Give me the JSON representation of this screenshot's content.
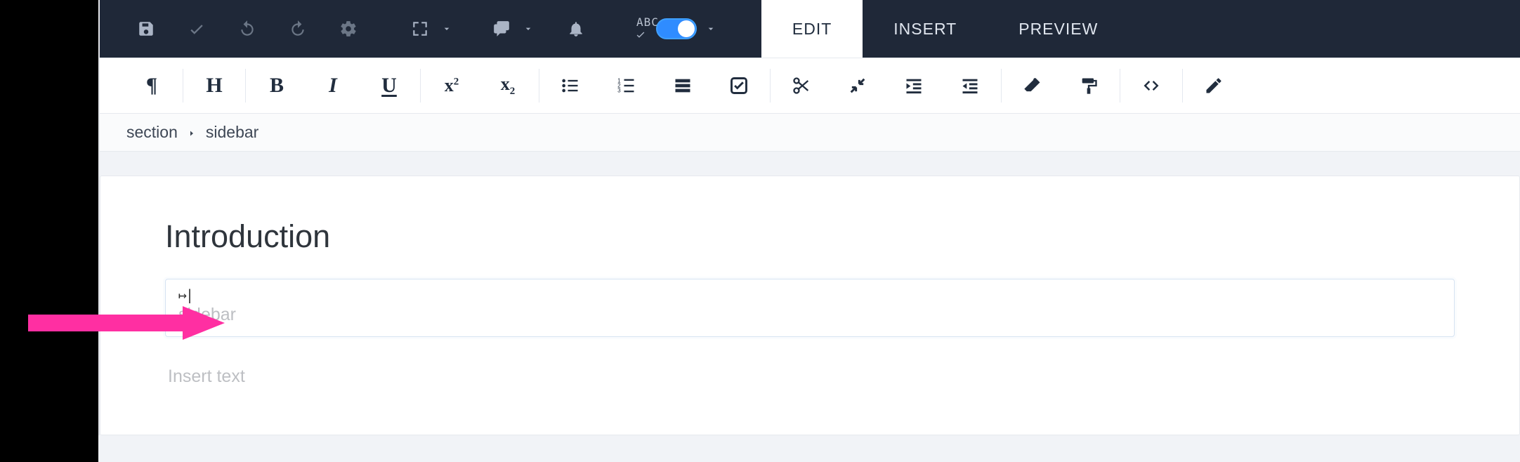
{
  "topbar": {
    "spellcheck_label": "ABC"
  },
  "tabs": {
    "edit": "EDIT",
    "insert": "INSERT",
    "preview": "PREVIEW"
  },
  "breadcrumb": {
    "item1": "section",
    "item2": "sidebar"
  },
  "document": {
    "heading": "Introduction",
    "sidebar_tab_marker": "↦|",
    "sidebar_placeholder": "sidebar",
    "insert_placeholder": "Insert text"
  }
}
